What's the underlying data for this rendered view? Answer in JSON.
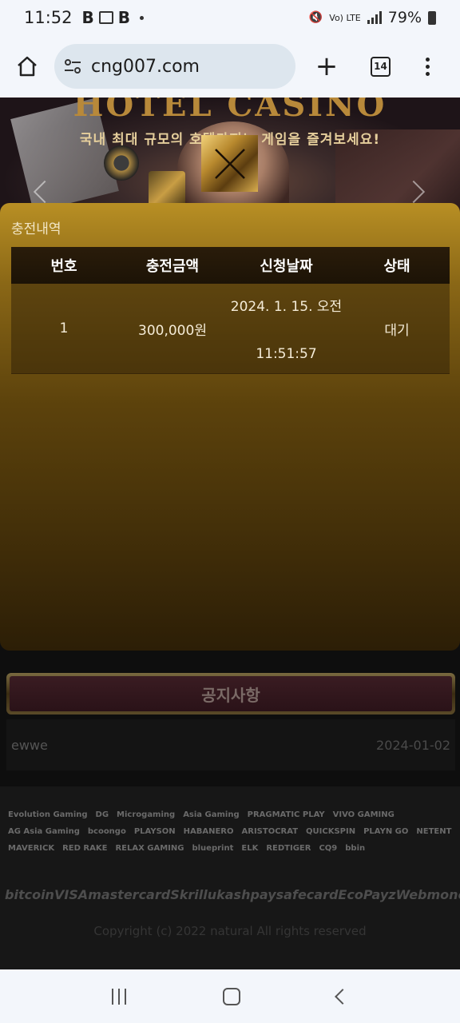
{
  "status_bar": {
    "time": "11:52",
    "app_icon_letter": "B",
    "network": "Vo) LTE",
    "network_sub": "LTE",
    "battery": "79%"
  },
  "browser": {
    "url": "cng007.com",
    "tab_count": "14"
  },
  "banner": {
    "title": "HOTEL CASINO",
    "subtitle": "국내 최대 규모의 호텔카지노 게임을 즐겨보세요!"
  },
  "modal": {
    "title": "충전내역",
    "columns": [
      "번호",
      "충전금액",
      "신청날짜",
      "상태"
    ],
    "rows": [
      {
        "no": "1",
        "amount": "300,000원",
        "date_line1": "2024. 1. 15. 오전",
        "date_line2": "11:51:57",
        "status": "대기"
      }
    ]
  },
  "notice": {
    "label": "공지사항",
    "items": [
      {
        "title": "ewwe",
        "date": "2024-01-02"
      }
    ]
  },
  "footer": {
    "providers": [
      "Evolution Gaming",
      "DG",
      "Microgaming",
      "Asia Gaming",
      "PRAGMATIC PLAY",
      "VIVO GAMING",
      "AG Asia Gaming",
      "bcoongo",
      "PLAYSON",
      "HABANERO",
      "ARISTOCRAT",
      "QUICKSPIN",
      "PLAYN GO",
      "NETENT",
      "MAVERICK",
      "RED RAKE",
      "RELAX GAMING",
      "blueprint",
      "ELK",
      "REDTIGER",
      "CQ9",
      "bbin"
    ],
    "payments": [
      "bitcoin",
      "VISA",
      "mastercard",
      "Skrill",
      "ukash",
      "paysafecard",
      "EcoPayz",
      "Webmoney"
    ],
    "copyright": "Copyright (c) 2022 natural All rights reserved"
  }
}
